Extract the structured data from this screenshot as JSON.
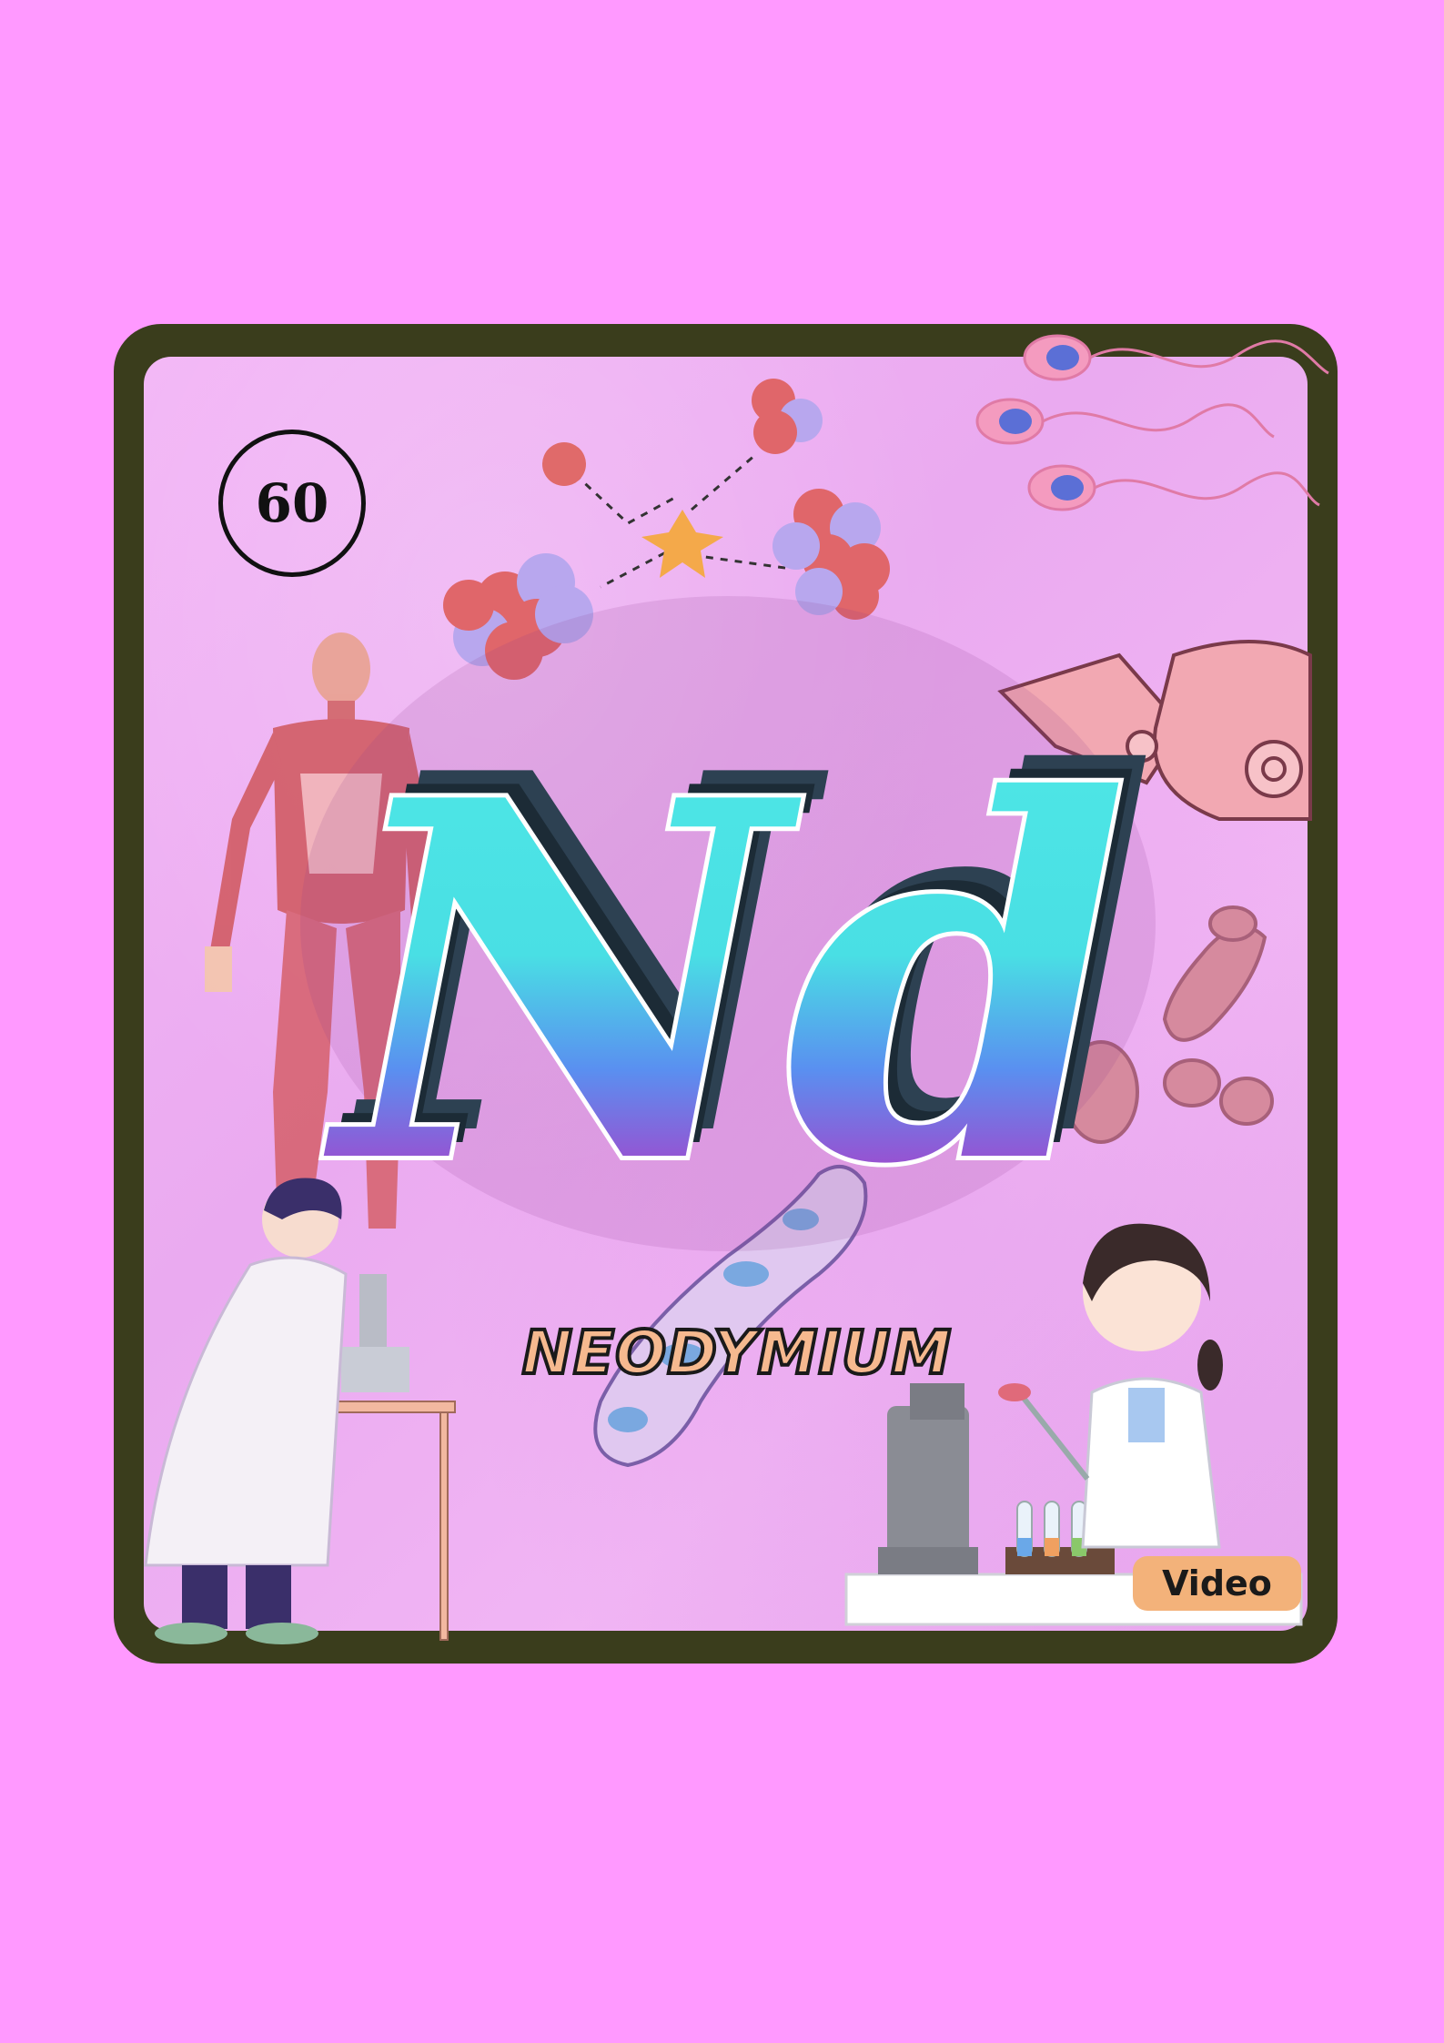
{
  "element": {
    "atomic_number": "60",
    "symbol": "Nd",
    "name": "NEODYMIUM"
  },
  "actions": {
    "video_label": "Video"
  },
  "icons": [
    "atom-structure-icon",
    "sperm-cells-icon",
    "human-muscle-anatomy-icon",
    "robotic-arm-icon",
    "bacteria-icon",
    "scientist-with-microscope-icon",
    "scientist-with-test-tubes-icon"
  ],
  "colors": {
    "page_background": "#ff99ff",
    "frame": "#3a3d1c",
    "card": "#f1b3f4",
    "symbol_gradient_top": "#4fe8e6",
    "symbol_gradient_mid": "#5a8ff0",
    "symbol_gradient_bottom": "#e0208f",
    "symbol_shadow": "#1c2b36",
    "name_fill": "#f6b98f",
    "video_button": "#f3b27a"
  }
}
